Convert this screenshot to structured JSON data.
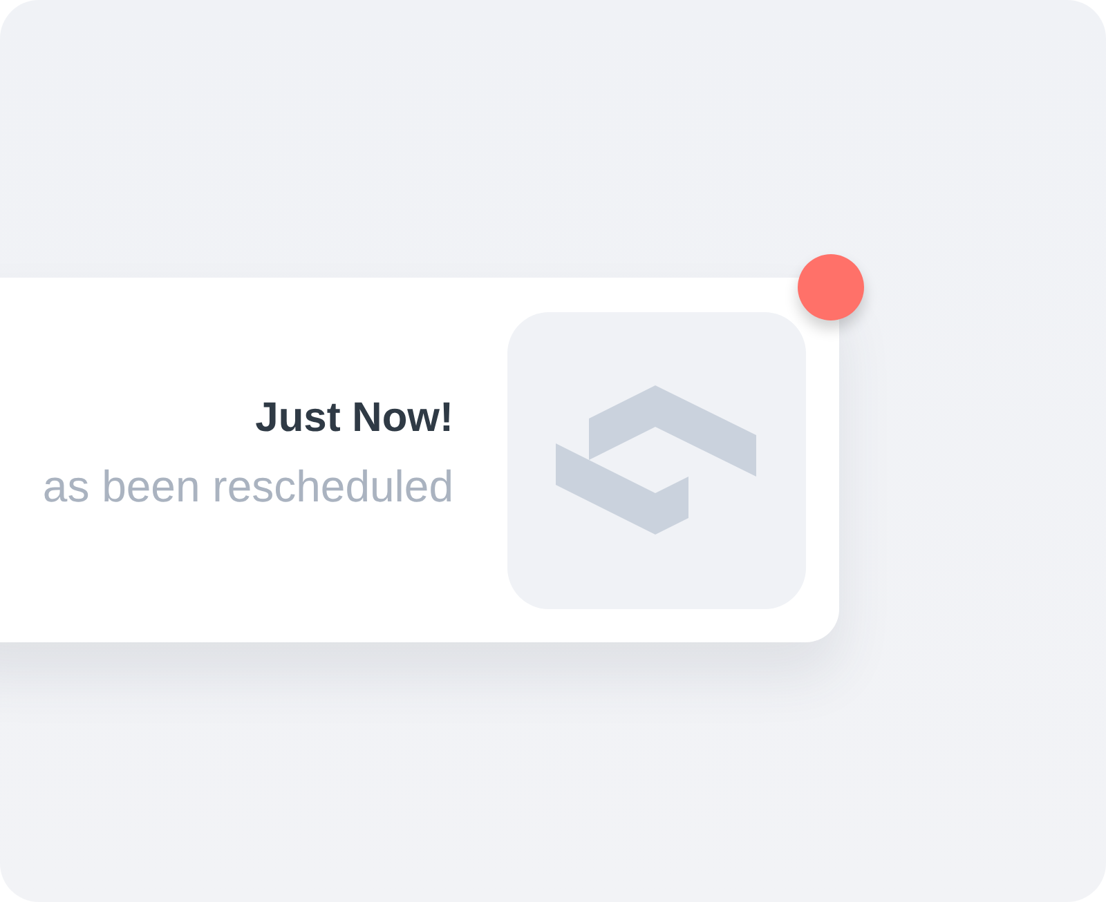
{
  "notification": {
    "title": "Just Now!",
    "message": "as been rescheduled",
    "unread": true
  }
}
